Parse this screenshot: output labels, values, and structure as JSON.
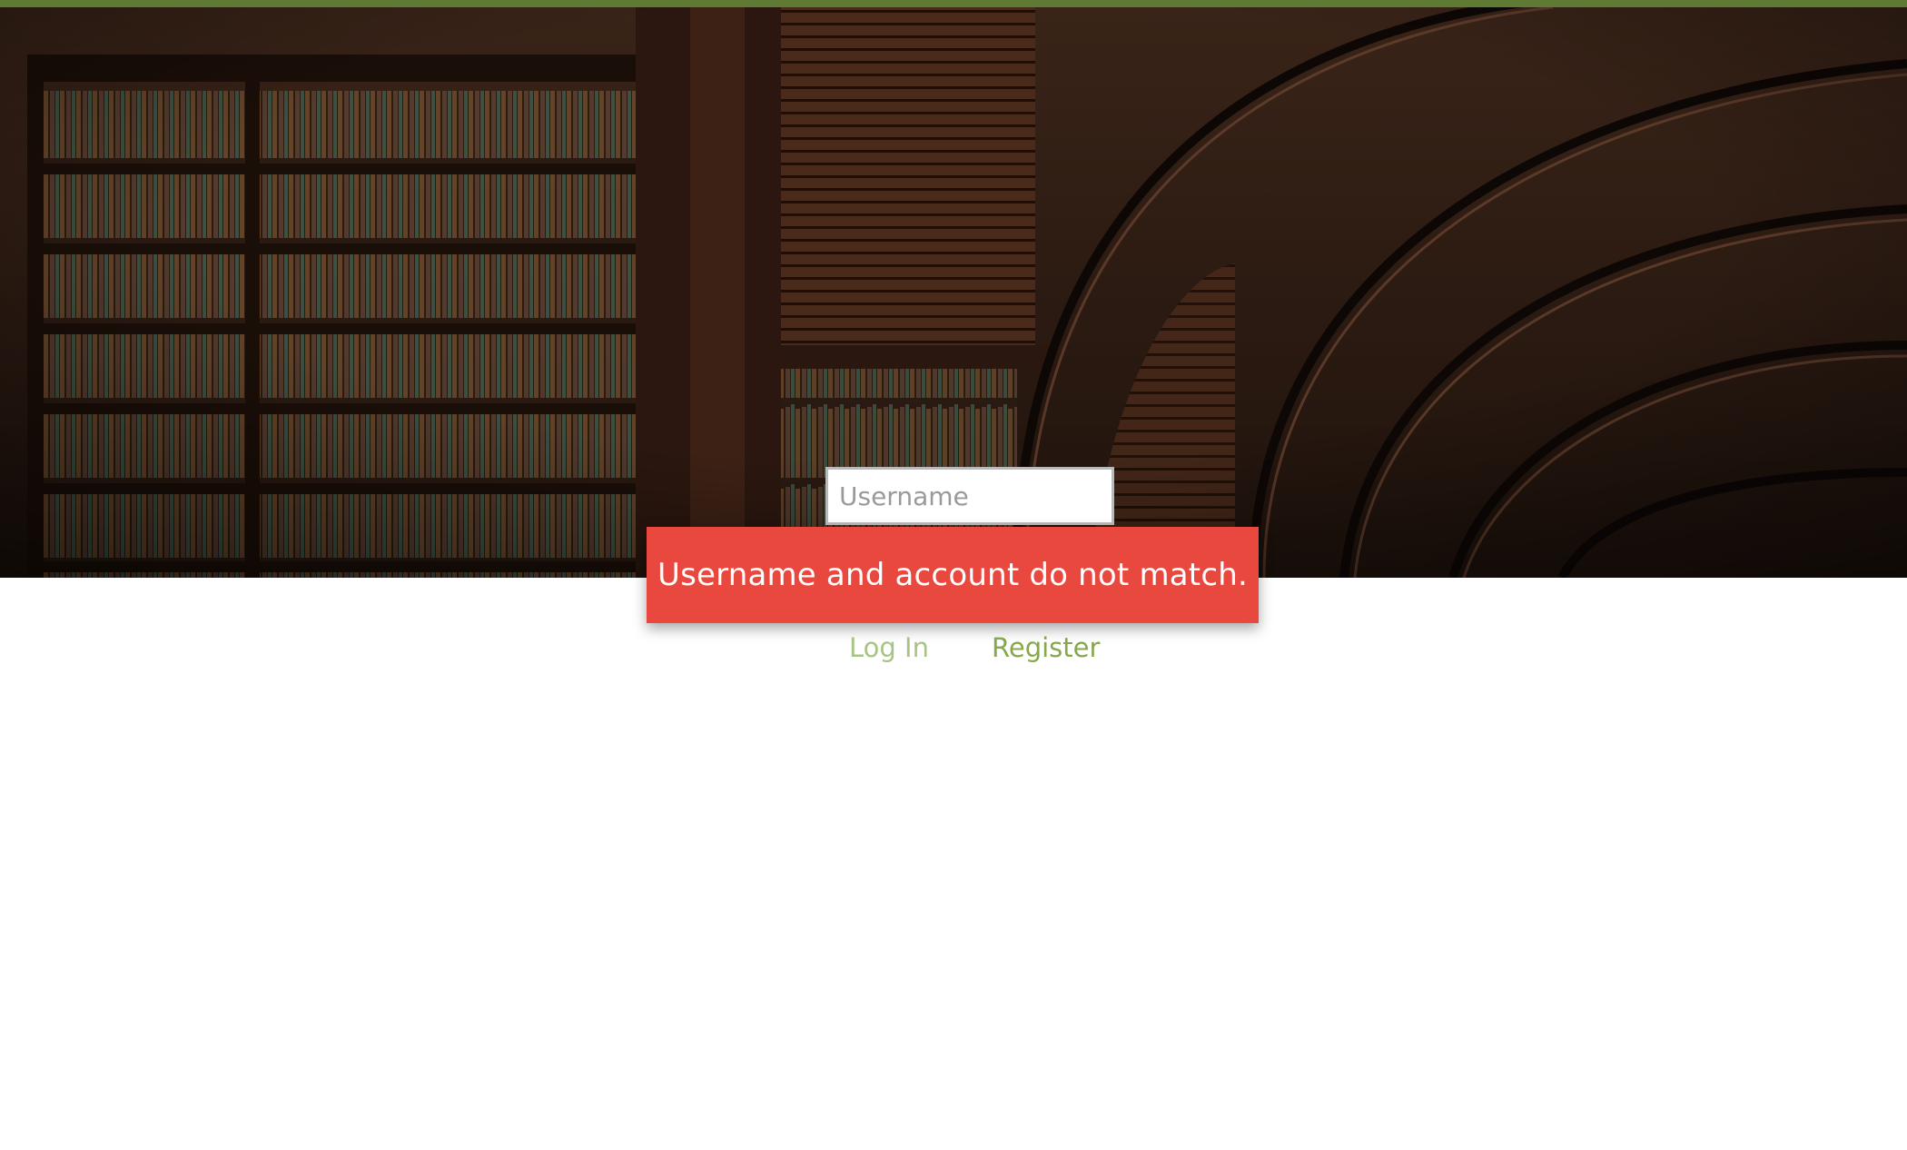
{
  "login": {
    "username_placeholder": "Username",
    "username_value": ""
  },
  "error": {
    "message": "Username and account do not match."
  },
  "links": {
    "login_label": "Log In",
    "register_label": "Register"
  },
  "colors": {
    "top_bar": "#5f7a32",
    "error_background": "#e9483e",
    "login_link": "#a8c484",
    "register_link": "#86a84a"
  },
  "hero": {
    "image": "library-interior-photo"
  }
}
